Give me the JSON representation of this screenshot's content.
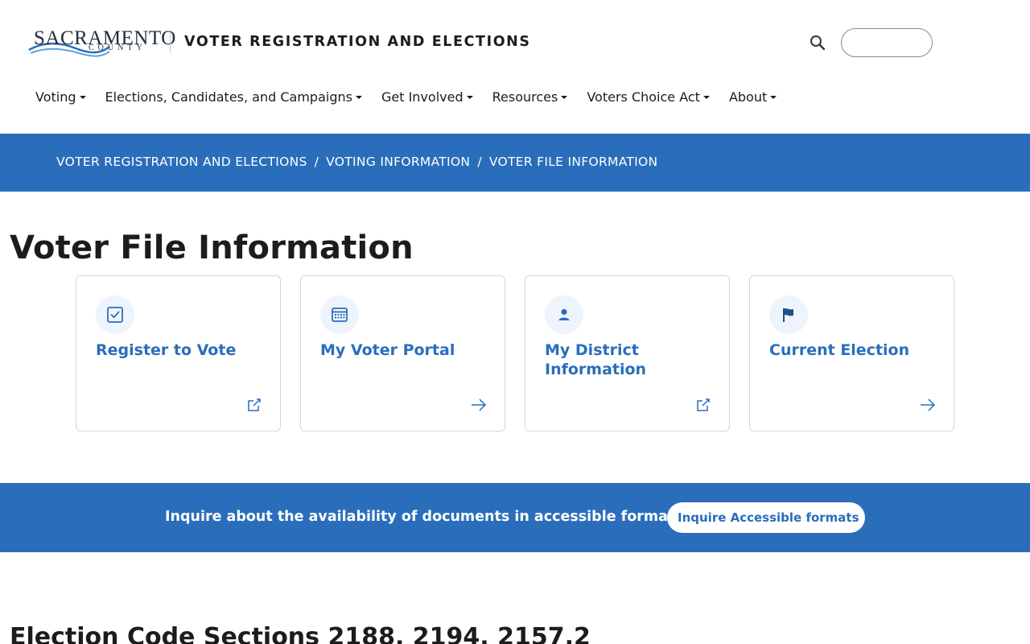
{
  "header": {
    "logo_word": "SACRAMENTO",
    "logo_sub": "COUNTY",
    "department_title": "VOTER REGISTRATION AND ELECTIONS",
    "search_icon": "search-icon",
    "language_select_value": ""
  },
  "nav": {
    "items": [
      {
        "label": "Voting"
      },
      {
        "label": "Elections, Candidates, and Campaigns"
      },
      {
        "label": "Get Involved"
      },
      {
        "label": "Resources"
      },
      {
        "label": "Voters Choice Act"
      },
      {
        "label": "About"
      }
    ]
  },
  "breadcrumb": {
    "items": [
      "VOTER REGISTRATION AND ELECTIONS",
      "VOTING INFORMATION",
      "VOTER FILE INFORMATION"
    ],
    "separator": "/"
  },
  "page": {
    "title": "Voter File Information"
  },
  "cards": [
    {
      "title": "Register to Vote",
      "icon": "checkbox-icon",
      "foot_icon": "external-link-icon"
    },
    {
      "title": "My Voter Portal",
      "icon": "calendar-icon",
      "foot_icon": "arrow-right-icon"
    },
    {
      "title": "My District Information",
      "icon": "person-icon",
      "foot_icon": "external-link-icon"
    },
    {
      "title": "Current Election",
      "icon": "flag-icon",
      "foot_icon": "arrow-right-icon"
    }
  ],
  "accessibility": {
    "text": "Inquire about the availability of documents in accessible formats.",
    "button_label": "Inquire Accessible formats"
  },
  "section": {
    "title": "Election Code Sections 2188, 2194, 2157.2"
  },
  "colors": {
    "brand_blue": "#2a6ebb",
    "card_icon_bg": "#eef4fb",
    "text_dark": "#1c1c1c"
  }
}
